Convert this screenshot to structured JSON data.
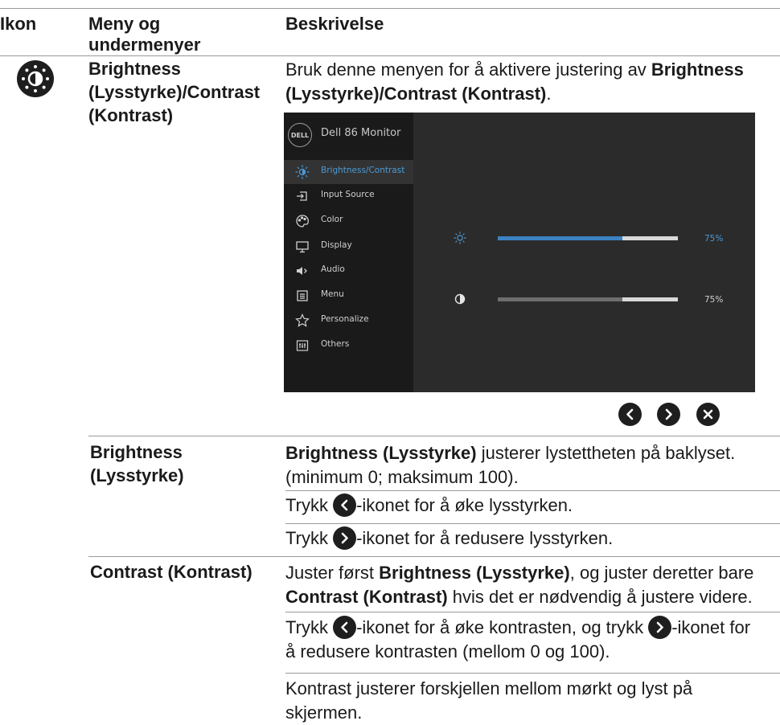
{
  "header": {
    "col_icon": "Ikon",
    "col_menu": "Meny og undermenyer",
    "col_desc": "Beskrivelse"
  },
  "brightness_contrast": {
    "menu_name_l1": "Brightness",
    "menu_name_l2": "(Lysstyrke)/Contrast",
    "menu_name_l3": "(Kontrast)",
    "desc_l1_plain": "Bruk denne menyen for å aktivere justering av ",
    "desc_l1_bold": "Brightness",
    "desc_l2_bold": "(Lysstyrke)/Contrast (Kontrast)",
    "desc_l2_end": "."
  },
  "osd": {
    "title": "Dell 86 Monitor",
    "logo": "DELL",
    "menu_items": [
      {
        "label": "Brightness/Contrast",
        "icon": "brightness-icon",
        "active": true
      },
      {
        "label": "Input Source",
        "icon": "input-source-icon",
        "active": false
      },
      {
        "label": "Color",
        "icon": "color-palette-icon",
        "active": false
      },
      {
        "label": "Display",
        "icon": "display-icon",
        "active": false
      },
      {
        "label": "Audio",
        "icon": "speaker-icon",
        "active": false
      },
      {
        "label": "Menu",
        "icon": "menu-icon",
        "active": false
      },
      {
        "label": "Personalize",
        "icon": "star-icon",
        "active": false
      },
      {
        "label": "Others",
        "icon": "others-icon",
        "active": false
      }
    ],
    "brightness_value": "75%",
    "brightness_level": 0.69,
    "contrast_value": "75%",
    "contrast_level": 0.69,
    "accent_color": "#4b9bd6",
    "nav_buttons": [
      "previous-icon",
      "next-icon",
      "close-icon"
    ]
  },
  "brightness": {
    "menu_name_l1": "Brightness",
    "menu_name_l2": "(Lysstyrke)",
    "desc_l1_bold": "Brightness (Lysstyrke)",
    "desc_l1_plain": " justerer lystettheten på baklyset.",
    "desc_l2": "(minimum 0; maksimum 100).",
    "press_prefix": "Trykk ",
    "increase_text": "-ikonet for å øke lysstyrken.",
    "decrease_text": "-ikonet for å redusere lysstyrken."
  },
  "contrast": {
    "menu_name": "Contrast (Kontrast)",
    "desc_l1_plain": "Juster først ",
    "desc_l1_bold": "Brightness (Lysstyrke)",
    "desc_l1_end": ", og juster deretter bare",
    "desc_l2_bold": "Contrast (Kontrast)",
    "desc_l2_end": " hvis det er nødvendig å justere videre.",
    "press_prefix": "Trykk ",
    "increase_text": "-ikonet for å øke kontrasten, og trykk ",
    "icon_for": "-ikonet for",
    "decrease_text": "å redusere kontrasten (mellom 0 og 100).",
    "note_l1": "Kontrast justerer forskjellen mellom mørkt og lyst på",
    "note_l2": "skjermen."
  }
}
